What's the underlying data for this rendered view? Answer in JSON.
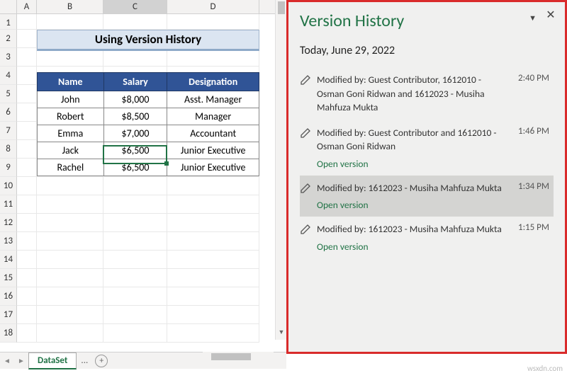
{
  "columns": [
    "A",
    "B",
    "C",
    "D"
  ],
  "rows": [
    "1",
    "2",
    "3",
    "4",
    "5",
    "6",
    "7",
    "8",
    "9",
    "10",
    "11",
    "12",
    "13",
    "14",
    "15",
    "16",
    "17",
    "18"
  ],
  "active_column": "C",
  "title_banner": "Using Version History",
  "table": {
    "headers": [
      "Name",
      "Salary",
      "Designation"
    ],
    "rows": [
      [
        "John",
        "$8,000",
        "Asst. Manager"
      ],
      [
        "Robert",
        "$8,500",
        "Manager"
      ],
      [
        "Emma",
        "$7,000",
        "Accountant"
      ],
      [
        "Jack",
        "$6,500",
        "Junior Executive"
      ],
      [
        "Rachel",
        "$6,500",
        "Junior Executive"
      ]
    ]
  },
  "version_history": {
    "title": "Version History",
    "date_heading": "Today, June 29, 2022",
    "open_label": "Open version",
    "items": [
      {
        "modified": "Modified by: Guest Contributor, 1612010 - Osman Goni Ridwan and 1612023 - Musiha Mahfuza Mukta",
        "time": "2:40 PM",
        "show_open": false,
        "selected": false
      },
      {
        "modified": "Modified by: Guest Contributor and 1612010 - Osman Goni Ridwan",
        "time": "1:46 PM",
        "show_open": true,
        "selected": false
      },
      {
        "modified": "Modified by: 1612023 - Musiha Mahfuza Mukta",
        "time": "1:34 PM",
        "show_open": true,
        "selected": true
      },
      {
        "modified": "Modified by: 1612023 - Musiha Mahfuza Mukta",
        "time": "1:15 PM",
        "show_open": true,
        "selected": false
      }
    ]
  },
  "tabs": {
    "active": "DataSet",
    "more": "..."
  },
  "watermark": "wsxdn.com"
}
